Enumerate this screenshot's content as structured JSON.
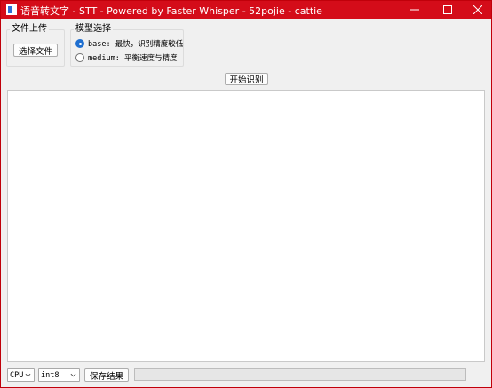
{
  "window": {
    "title": "语音转文字 - STT - Powered by Faster Whisper - 52pojie - cattie",
    "icon": "app-icon"
  },
  "upload_group": {
    "legend": "文件上传",
    "choose_button": "选择文件"
  },
  "model_group": {
    "legend": "模型选择",
    "options": [
      {
        "label": "base: 最快，识别精度较低",
        "checked": true
      },
      {
        "label": "medium: 平衡速度与精度",
        "checked": false
      }
    ]
  },
  "start_button": "开始识别",
  "result_text": "",
  "bottom": {
    "device_select": "CPU",
    "precision_select": "int8",
    "save_button": "保存结果",
    "progress": 0
  },
  "colors": {
    "titlebar": "#d40c19",
    "accent": "#1f6fd0",
    "window_bg": "#f0f0f0"
  }
}
